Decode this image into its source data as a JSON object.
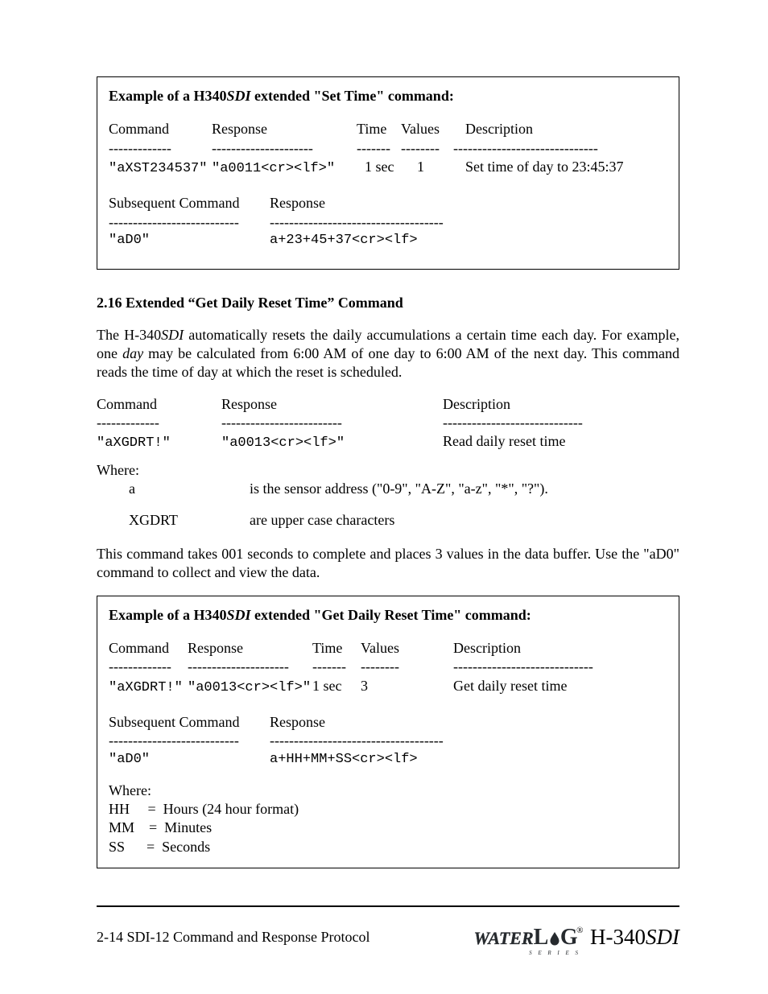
{
  "box1": {
    "title_prefix": "Example of a H340",
    "title_italic": "SDI",
    "title_suffix": " extended \"Set Time\" command:",
    "headers": {
      "command": "Command",
      "response": "Response",
      "time": "Time",
      "values": "Values",
      "description": "Description"
    },
    "dashes": {
      "command": "-------------",
      "response": "---------------------",
      "time": "-------",
      "values": "--------",
      "description": "------------------------------"
    },
    "row": {
      "command": "\"aXST234537\"",
      "response": "\"a0011<cr><lf>\"",
      "time": "1 sec",
      "values": "1",
      "description": "Set time of day to 23:45:37"
    },
    "sub_headers": {
      "command": "Subsequent Command",
      "response": "Response"
    },
    "sub_dashes": {
      "command": "---------------------------",
      "response": "------------------------------------"
    },
    "sub_row": {
      "command": "\"aD0\"",
      "response": "a+23+45+37<cr><lf>"
    }
  },
  "section": {
    "heading": "2.16  Extended “Get Daily Reset Time” Command",
    "para1_a": "The H-340",
    "para1_b": "SDI",
    "para1_c": " automatically resets the daily accumulations a certain time each day.  For example, one ",
    "para1_d": "day",
    "para1_e": " may be calculated from 6:00 AM of one day to 6:00 AM of the next day.  This command reads the time of day at which the reset is scheduled."
  },
  "midtable": {
    "headers": {
      "command": "Command",
      "response": "Response",
      "description": "Description"
    },
    "dashes": {
      "command": "-------------",
      "response": "-------------------------",
      "description": "-----------------------------"
    },
    "row": {
      "command": "\"aXGDRT!\"",
      "response": "\"a0013<cr><lf>\"",
      "description": "Read daily reset time"
    }
  },
  "where1": {
    "label": "Where:",
    "a_label": "a",
    "a_desc": "is the sensor address (\"0-9\", \"A-Z\", \"a-z\", \"*\", \"?\").",
    "x_label": "XGDRT",
    "x_desc": "are upper case characters"
  },
  "para2": "This command takes 001 seconds to complete and places 3 values in the data buffer.  Use the \"aD0\" command to collect and view the data.",
  "box2": {
    "title_prefix": "Example of a H340",
    "title_italic": "SDI",
    "title_suffix": " extended \"Get Daily Reset Time\" command:",
    "headers": {
      "command": "Command",
      "response": "Response",
      "time": "Time",
      "values": "Values",
      "description": "Description"
    },
    "dashes": {
      "command": "-------------",
      "response": "---------------------",
      "time": "-------",
      "values": "--------",
      "description": "-----------------------------"
    },
    "row": {
      "command": "\"aXGDRT!\"",
      "response": "\"a0013<cr><lf>\"",
      "time": "1 sec",
      "values": "3",
      "description": "Get daily reset time"
    },
    "sub_headers": {
      "command": "Subsequent Command",
      "response": "Response"
    },
    "sub_dashes": {
      "command": "---------------------------",
      "response": "------------------------------------"
    },
    "sub_row": {
      "command": "\"aD0\"",
      "response": "a+HH+MM+SS<cr><lf>"
    },
    "where": {
      "label": "Where:",
      "hh": "HH     =  Hours (24 hour format)",
      "mm": "MM    =  Minutes",
      "ss": "SS      =  Seconds"
    }
  },
  "footer": {
    "left": "2-14 SDI-12 Command and Response Protocol",
    "brand_water": "WATER",
    "brand_l": "L",
    "brand_g": "G",
    "series": "S E R I E S",
    "model_a": " H-340",
    "model_b": "SDI"
  }
}
